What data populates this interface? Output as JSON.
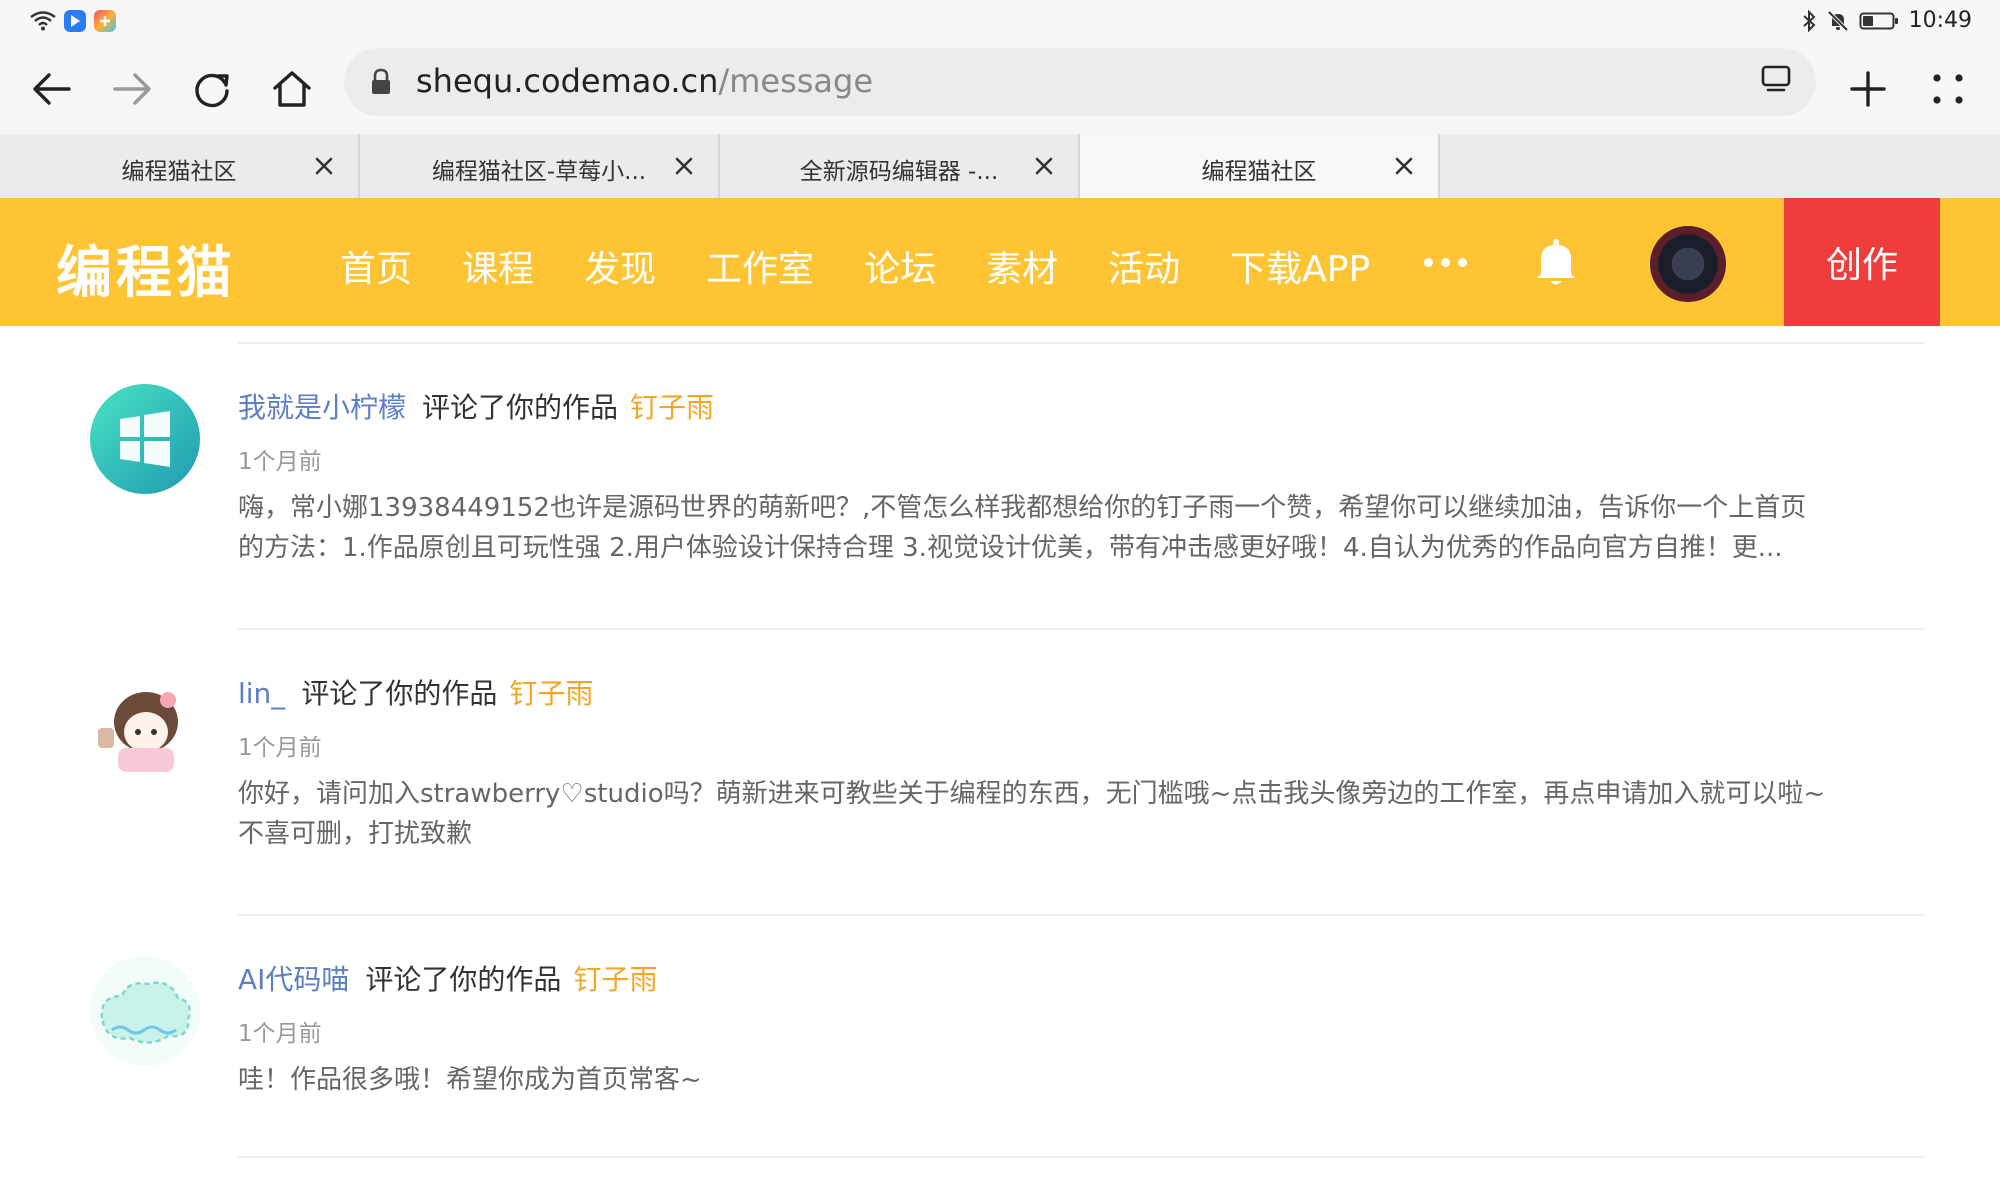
{
  "status": {
    "time": "10:49"
  },
  "browser": {
    "url_host": "shequ.codemao.cn",
    "url_path": "/message",
    "tabs": [
      {
        "title": "编程猫社区"
      },
      {
        "title": "编程猫社区-草莓小..."
      },
      {
        "title": "全新源码编辑器 -..."
      },
      {
        "title": "编程猫社区"
      }
    ]
  },
  "site": {
    "logo": "编程猫",
    "nav": [
      "首页",
      "课程",
      "发现",
      "工作室",
      "论坛",
      "素材",
      "活动",
      "下载APP"
    ],
    "create_label": "创作",
    "accent_color": "#fec433",
    "create_color": "#ef3d3d"
  },
  "messages": [
    {
      "user": "我就是小柠檬",
      "action": "评论了你的作品",
      "work": "钉子雨",
      "time": "1个月前",
      "body_lines": [
        "嗨，常小娜13938449152也许是源码世界的萌新吧？,不管怎么样我都想给你的钉子雨一个赞，希望你可以继续加油，告诉你一个上首页",
        "的方法：1.作品原创且可玩性强 2.用户体验设计保持合理 3.视觉设计优美，带有冲击感更好哦！4.自认为优秀的作品向官方自推！更..."
      ]
    },
    {
      "user": "lin_",
      "action": "评论了你的作品",
      "work": "钉子雨",
      "time": "1个月前",
      "body_lines": [
        "你好，请问加入strawberry♡studio吗？萌新进来可教些关于编程的东西，无门槛哦~点击我头像旁边的工作室，再点申请加入就可以啦~",
        "不喜可删，打扰致歉"
      ]
    },
    {
      "user": "AI代码喵",
      "action": "评论了你的作品",
      "work": "钉子雨",
      "time": "1个月前",
      "body_lines": [
        "哇！作品很多哦！希望你成为首页常客~"
      ]
    }
  ]
}
